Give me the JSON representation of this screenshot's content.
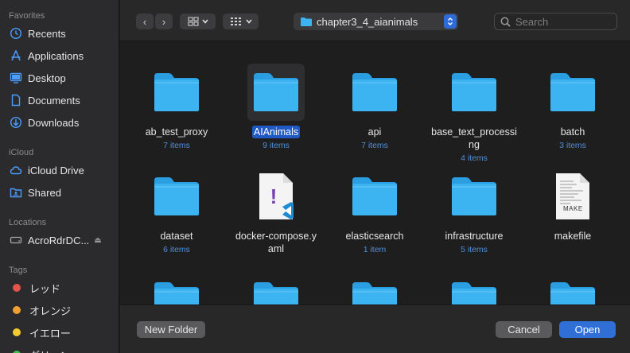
{
  "sidebar": {
    "favorites_title": "Favorites",
    "favorites": [
      {
        "label": "Recents",
        "icon": "clock-icon"
      },
      {
        "label": "Applications",
        "icon": "applications-icon"
      },
      {
        "label": "Desktop",
        "icon": "desktop-icon"
      },
      {
        "label": "Documents",
        "icon": "document-icon"
      },
      {
        "label": "Downloads",
        "icon": "download-icon"
      }
    ],
    "icloud_title": "iCloud",
    "icloud": [
      {
        "label": "iCloud Drive",
        "icon": "cloud-icon"
      },
      {
        "label": "Shared",
        "icon": "shared-folder-icon"
      }
    ],
    "locations_title": "Locations",
    "locations": [
      {
        "label": "AcroRdrDC...",
        "icon": "disk-icon"
      }
    ],
    "tags_title": "Tags",
    "tags": [
      {
        "label": "レッド",
        "color": "#e5534b"
      },
      {
        "label": "オレンジ",
        "color": "#f0a030"
      },
      {
        "label": "イエロー",
        "color": "#f2cc2e"
      },
      {
        "label": "グリーン",
        "color": "#3fbf4f"
      }
    ]
  },
  "toolbar": {
    "back_glyph": "‹",
    "forward_glyph": "›",
    "path": "chapter3_4_aianimals",
    "search_placeholder": "Search"
  },
  "items": [
    {
      "name": "ab_test_proxy",
      "count": "7 items",
      "type": "folder"
    },
    {
      "name": "AIAnimals",
      "count": "9 items",
      "type": "folder",
      "selected": true
    },
    {
      "name": "api",
      "count": "7 items",
      "type": "folder"
    },
    {
      "name": "base_text_processing",
      "count": "4 items",
      "type": "folder"
    },
    {
      "name": "batch",
      "count": "3 items",
      "type": "folder"
    },
    {
      "name": "dataset",
      "count": "6 items",
      "type": "folder"
    },
    {
      "name": "docker-compose.yaml",
      "count": "",
      "type": "yaml"
    },
    {
      "name": "elasticsearch",
      "count": "1 item",
      "type": "folder"
    },
    {
      "name": "infrastructure",
      "count": "5 items",
      "type": "folder"
    },
    {
      "name": "makefile",
      "count": "",
      "type": "makefile"
    },
    {
      "name": "",
      "count": "",
      "type": "folder"
    },
    {
      "name": "",
      "count": "",
      "type": "folder"
    },
    {
      "name": "",
      "count": "",
      "type": "folder"
    },
    {
      "name": "",
      "count": "",
      "type": "folder"
    },
    {
      "name": "",
      "count": "",
      "type": "folder"
    }
  ],
  "icons": {
    "makefile_badge": "MAKE",
    "yaml_glyph": "!"
  },
  "footer": {
    "new_folder_label": "New Folder",
    "cancel_label": "Cancel",
    "open_label": "Open"
  },
  "colors": {
    "accent": "#2f6fd6",
    "folder": "#3db4f2",
    "selection": "#2159c4",
    "item_count": "#4f8fd9"
  }
}
